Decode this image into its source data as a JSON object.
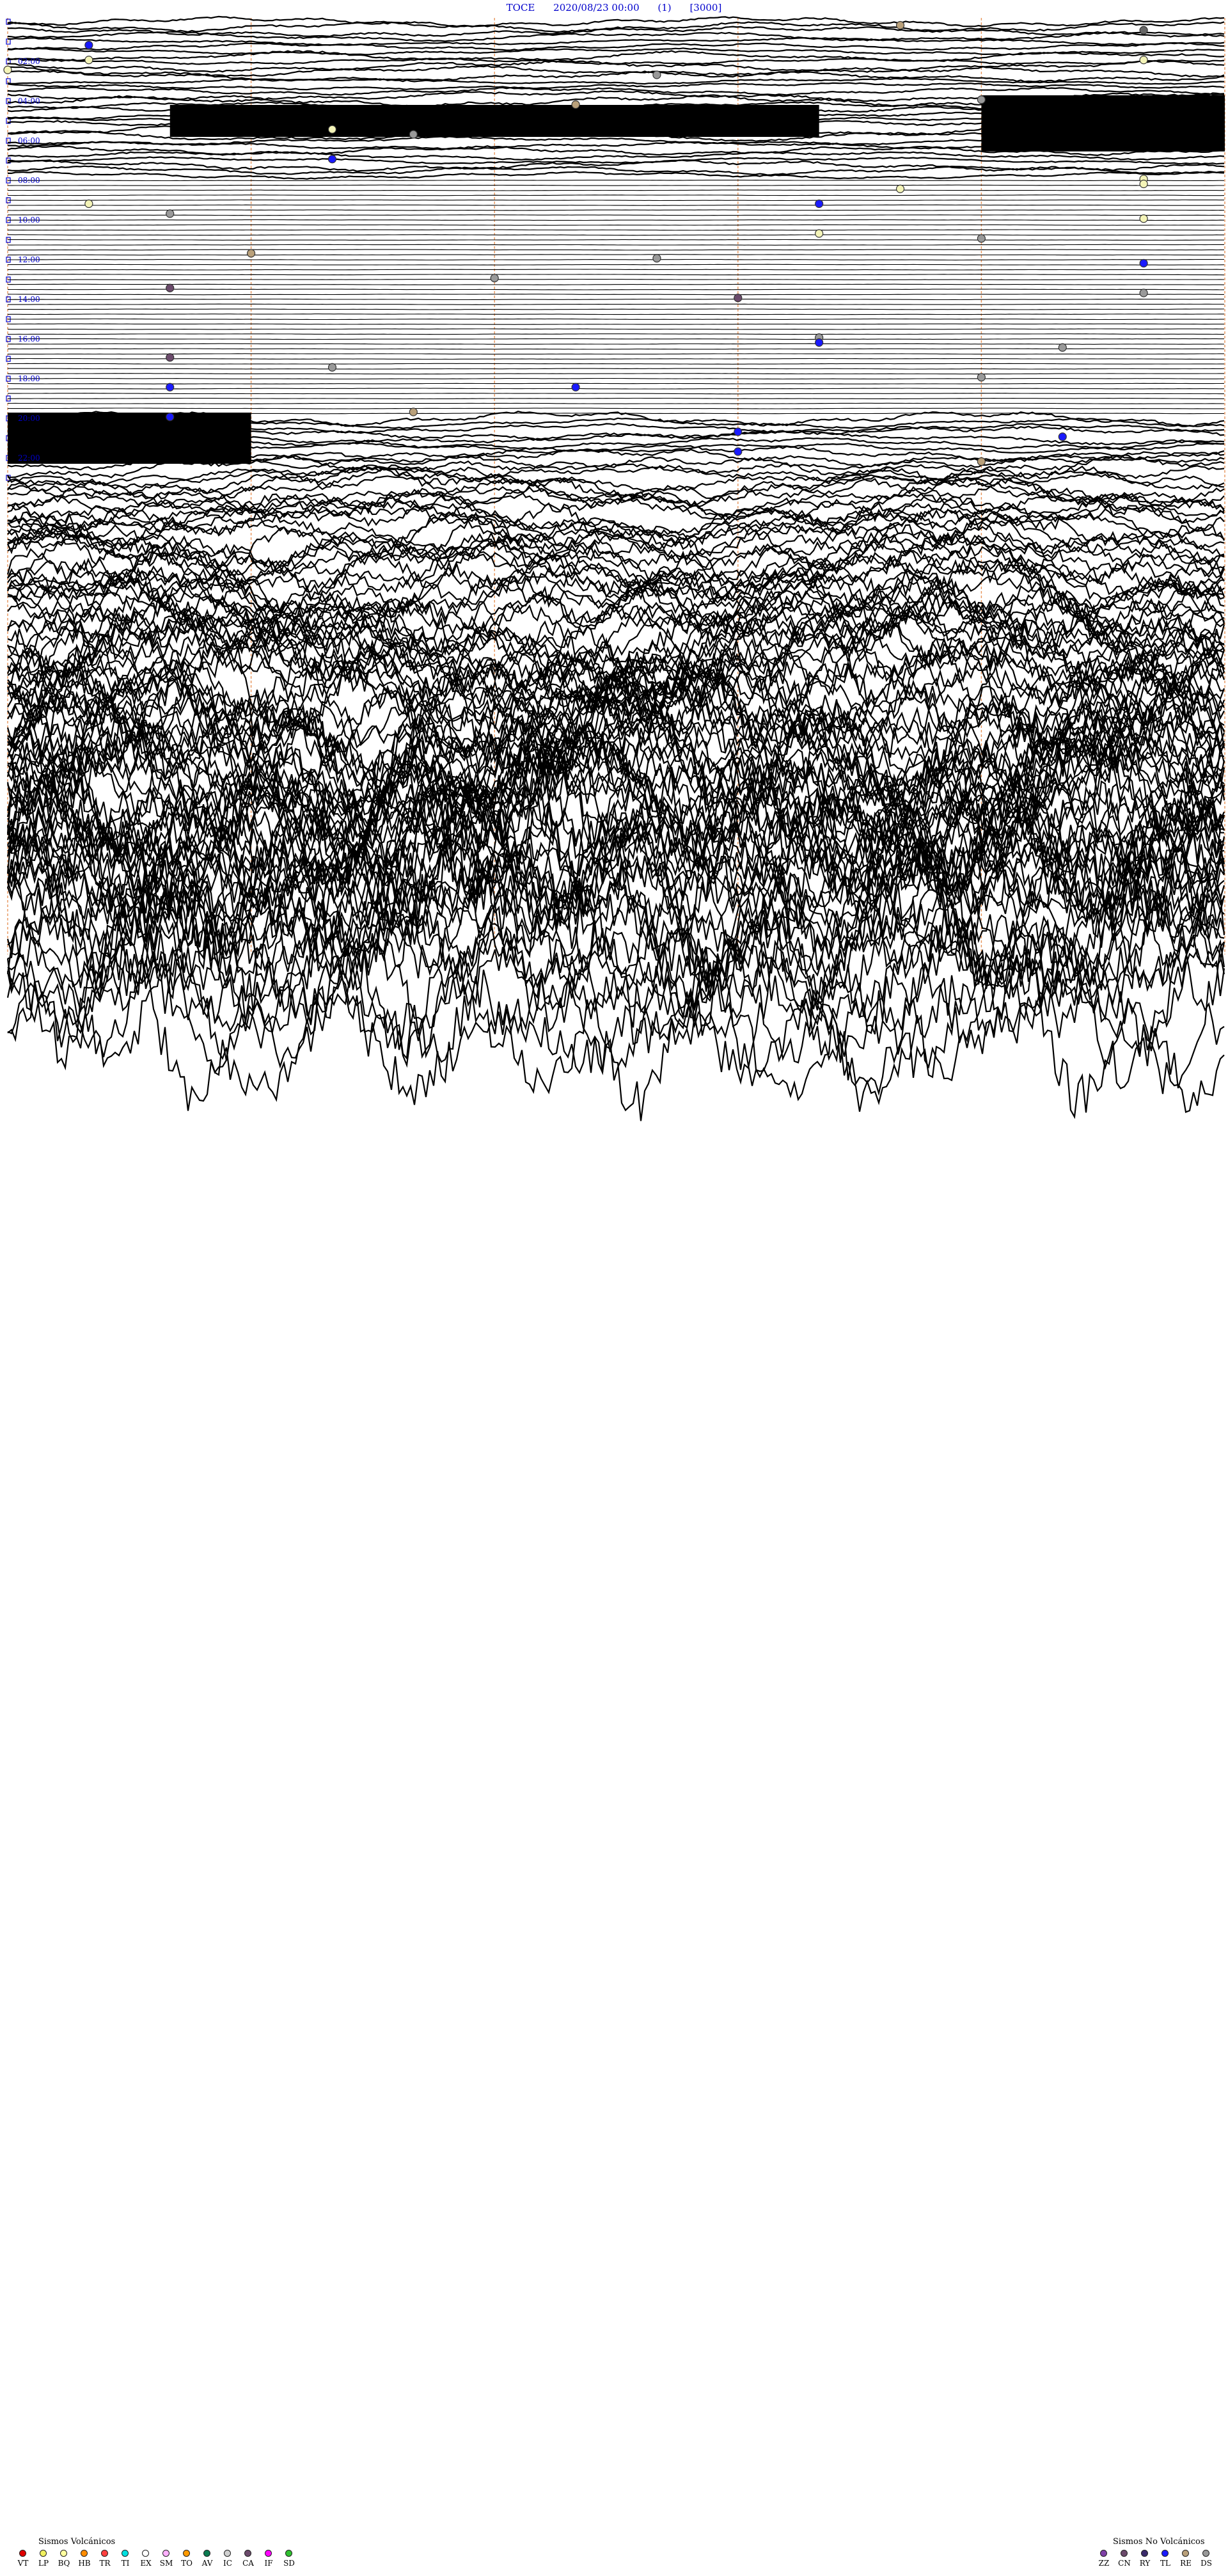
{
  "header": {
    "station": "TOCE",
    "datetime": "2020/08/23 00:00",
    "component": "(1)",
    "scale": "[3000]"
  },
  "chart_data": {
    "type": "seismogram",
    "title": "TOCE 2020/08/23 00:00 (1) [3000]",
    "grid": true,
    "hour_labels": [
      "02:00",
      "04:00",
      "06:00",
      "08:00",
      "10:00",
      "12:00",
      "14:00",
      "16:00",
      "18:00",
      "20:00",
      "22:00"
    ],
    "events": [
      {
        "time": "00:41",
        "type": "RE",
        "color": "#b9a07a"
      },
      {
        "time": "00:59",
        "type": "CN",
        "color": "#666666"
      },
      {
        "time": "01:31",
        "type": "TL",
        "color": "#1a1aff"
      },
      {
        "time": "02:16",
        "type": "LP",
        "color": "#f4f4b8"
      },
      {
        "time": "02:29",
        "type": "LP",
        "color": "#f4f4b8"
      },
      {
        "time": "02:45",
        "type": "LP",
        "color": "#f4f4b8"
      },
      {
        "time": "03:08",
        "type": "DS",
        "color": "#999999"
      },
      {
        "time": "04:27",
        "type": "DS",
        "color": "#999999"
      },
      {
        "time": "04:37",
        "type": "RE",
        "color": "#b9a07a"
      },
      {
        "time": "05:49",
        "type": "LP",
        "color": "#f4f4b8"
      },
      {
        "time": "06:05",
        "type": "DS",
        "color": "#999999"
      },
      {
        "time": "07:19",
        "type": "TL",
        "color": "#1a1aff"
      },
      {
        "time": "08:29",
        "type": "LP",
        "color": "#f4f4b8"
      },
      {
        "time": "08:44",
        "type": "LP",
        "color": "#f4f4b8"
      },
      {
        "time": "08:56",
        "type": "LP",
        "color": "#f4f4b8"
      },
      {
        "time": "09:31",
        "type": "LP",
        "color": "#f4f4b8"
      },
      {
        "time": "09:40",
        "type": "TL",
        "color": "#1a1aff"
      },
      {
        "time": "10:02",
        "type": "DS",
        "color": "#999999"
      },
      {
        "time": "10:29",
        "type": "LP",
        "color": "#f4f4b8"
      },
      {
        "time": "11:10",
        "type": "LP",
        "color": "#f4f4b8"
      },
      {
        "time": "11:27",
        "type": "DS",
        "color": "#999999"
      },
      {
        "time": "12:03",
        "type": "RE",
        "color": "#b9a07a"
      },
      {
        "time": "12:23",
        "type": "DS",
        "color": "#999999"
      },
      {
        "time": "12:44",
        "type": "TL",
        "color": "#1a1aff"
      },
      {
        "time": "13:21",
        "type": "DS",
        "color": "#999999"
      },
      {
        "time": "13:47",
        "type": "CN",
        "color": "#6b4a6b"
      },
      {
        "time": "14:14",
        "type": "DS",
        "color": "#999999"
      },
      {
        "time": "14:24",
        "type": "CN",
        "color": "#6b4a6b"
      },
      {
        "time": "16:25",
        "type": "DS",
        "color": "#999999"
      },
      {
        "time": "16:40",
        "type": "TL",
        "color": "#1a1aff"
      },
      {
        "time": "16:58",
        "type": "DS",
        "color": "#999999"
      },
      {
        "time": "17:17",
        "type": "CN",
        "color": "#6b4a6b"
      },
      {
        "time": "17:49",
        "type": "DS",
        "color": "#999999"
      },
      {
        "time": "18:27",
        "type": "DS",
        "color": "#999999"
      },
      {
        "time": "18:47",
        "type": "TL",
        "color": "#1a1aff"
      },
      {
        "time": "18:52",
        "type": "TL",
        "color": "#1a1aff"
      },
      {
        "time": "20:05",
        "type": "RE",
        "color": "#b9a07a"
      },
      {
        "time": "20:17",
        "type": "TL",
        "color": "#1a1aff"
      },
      {
        "time": "21:09",
        "type": "TL",
        "color": "#1a1aff"
      },
      {
        "time": "21:28",
        "type": "TL",
        "color": "#1a1aff"
      },
      {
        "time": "22:09",
        "type": "TL",
        "color": "#1a1aff"
      },
      {
        "time": "22:42",
        "type": "RE",
        "color": "#b9a07a"
      }
    ],
    "bursts": [
      {
        "start": "05:02",
        "end": "05:10",
        "amplitude": "high"
      },
      {
        "start": "05:12",
        "end": "05:29",
        "amplitude": "very-high"
      },
      {
        "start": "21:00",
        "end": "21:03",
        "amplitude": "very-high"
      }
    ]
  },
  "legend": {
    "volcanic_title": "Sismos Volcánicos",
    "volcanic": [
      {
        "code": "VT",
        "color": "#e00000"
      },
      {
        "code": "LP",
        "color": "#f0f060"
      },
      {
        "code": "BQ",
        "color": "#ffffa0"
      },
      {
        "code": "HB",
        "color": "#ff8c00"
      },
      {
        "code": "TR",
        "color": "#ff4040"
      },
      {
        "code": "TI",
        "color": "#00e0e0"
      },
      {
        "code": "EX",
        "color": "#ffffff"
      },
      {
        "code": "SM",
        "color": "#ffb0ff"
      },
      {
        "code": "TO",
        "color": "#ff9a00"
      },
      {
        "code": "AV",
        "color": "#0a7a50"
      },
      {
        "code": "IC",
        "color": "#d0d0d0"
      },
      {
        "code": "CA",
        "color": "#6b4a6b"
      },
      {
        "code": "IF",
        "color": "#ff00ff"
      },
      {
        "code": "SD",
        "color": "#30c030"
      }
    ],
    "nonvolcanic_title": "Sismos No Volcánicos",
    "nonvolcanic": [
      {
        "code": "ZZ",
        "color": "#7e3fa6"
      },
      {
        "code": "CN",
        "color": "#6b4a6b"
      },
      {
        "code": "RY",
        "color": "#3a2a6b"
      },
      {
        "code": "TL",
        "color": "#1a1aff"
      },
      {
        "code": "RE",
        "color": "#b9a07a"
      },
      {
        "code": "DS",
        "color": "#999999"
      }
    ]
  }
}
